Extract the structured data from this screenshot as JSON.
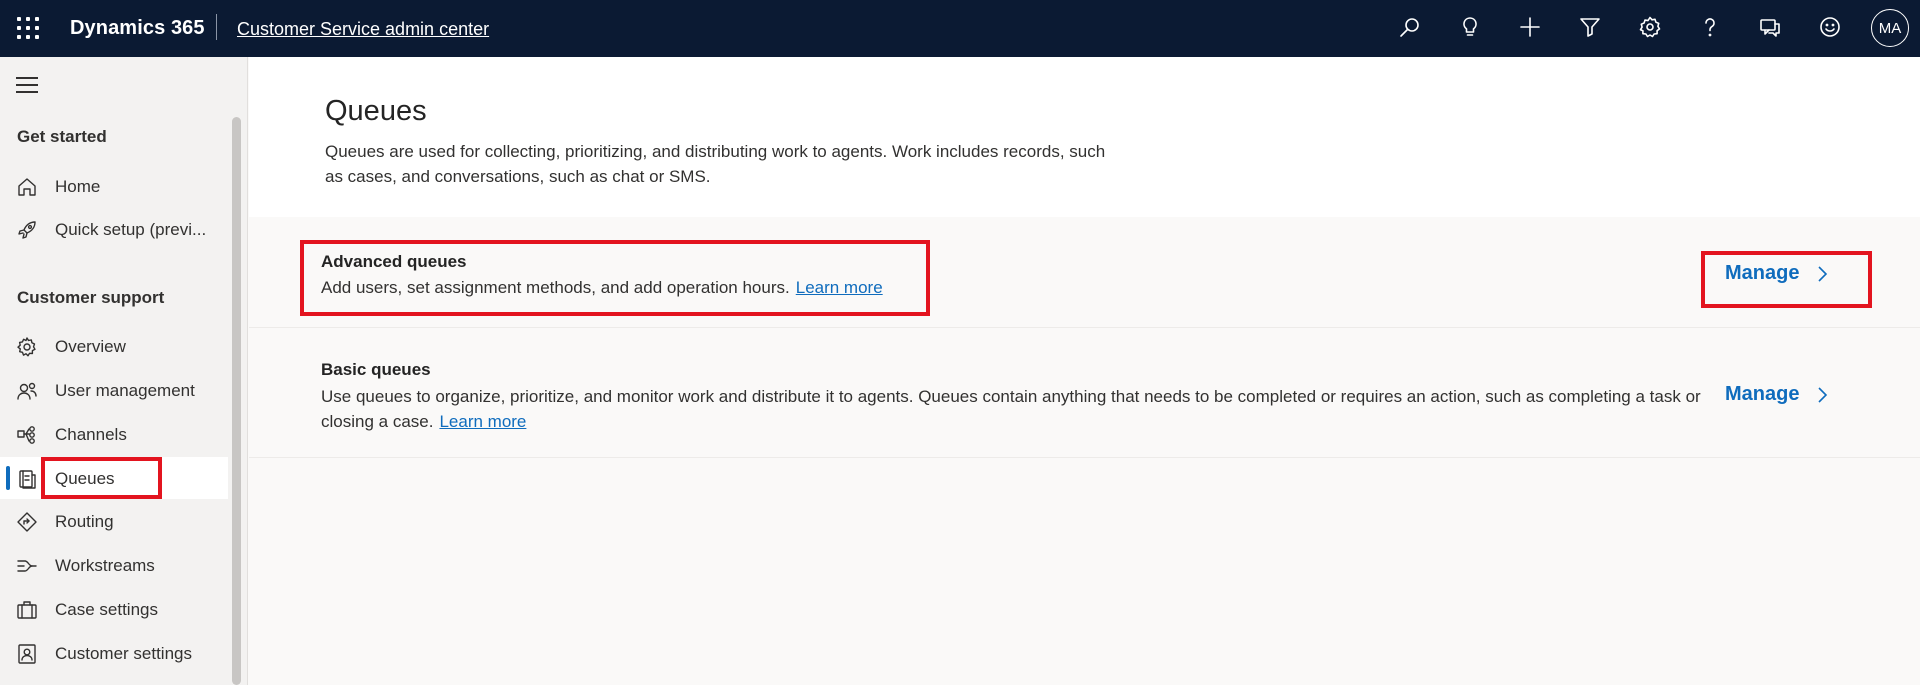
{
  "topbar": {
    "brand": "Dynamics 365",
    "app_name": "Customer Service admin center",
    "icons": [
      "search-icon",
      "lightbulb-icon",
      "add-icon",
      "filter-icon",
      "settings-icon",
      "help-icon",
      "feedback-icon",
      "smiley-icon"
    ],
    "avatar_initials": "MA",
    "background_color": "#0b1a33"
  },
  "sidebar": {
    "sections": [
      {
        "title": "Get started",
        "items": [
          {
            "label": "Home",
            "icon": "home-icon"
          },
          {
            "label": "Quick setup (previ...",
            "icon": "rocket-icon"
          }
        ]
      },
      {
        "title": "Customer support",
        "items": [
          {
            "label": "Overview",
            "icon": "overview-gear-icon"
          },
          {
            "label": "User management",
            "icon": "users-icon"
          },
          {
            "label": "Channels",
            "icon": "channels-icon"
          },
          {
            "label": "Queues",
            "icon": "queues-icon",
            "selected": true
          },
          {
            "label": "Routing",
            "icon": "routing-icon"
          },
          {
            "label": "Workstreams",
            "icon": "workstreams-icon"
          },
          {
            "label": "Case settings",
            "icon": "briefcase-icon"
          },
          {
            "label": "Customer settings",
            "icon": "contact-card-icon"
          }
        ]
      }
    ],
    "accent_color": "#0f6cbd"
  },
  "main": {
    "title": "Queues",
    "description": "Queues are used for collecting, prioritizing, and distributing work to agents. Work includes records, such as cases, and conversations, such as chat or SMS.",
    "rows": [
      {
        "title": "Advanced queues",
        "description": "Add users, set assignment methods, and add operation hours.",
        "link": "Learn more",
        "action": "Manage"
      },
      {
        "title": "Basic queues",
        "description": "Use queues to organize, prioritize, and monitor work and distribute it to agents. Queues contain anything that needs to be completed or requires an action, such as completing a task or closing a case.",
        "link": "Learn more",
        "action": "Manage"
      }
    ],
    "highlight_color": "#e3141f"
  }
}
